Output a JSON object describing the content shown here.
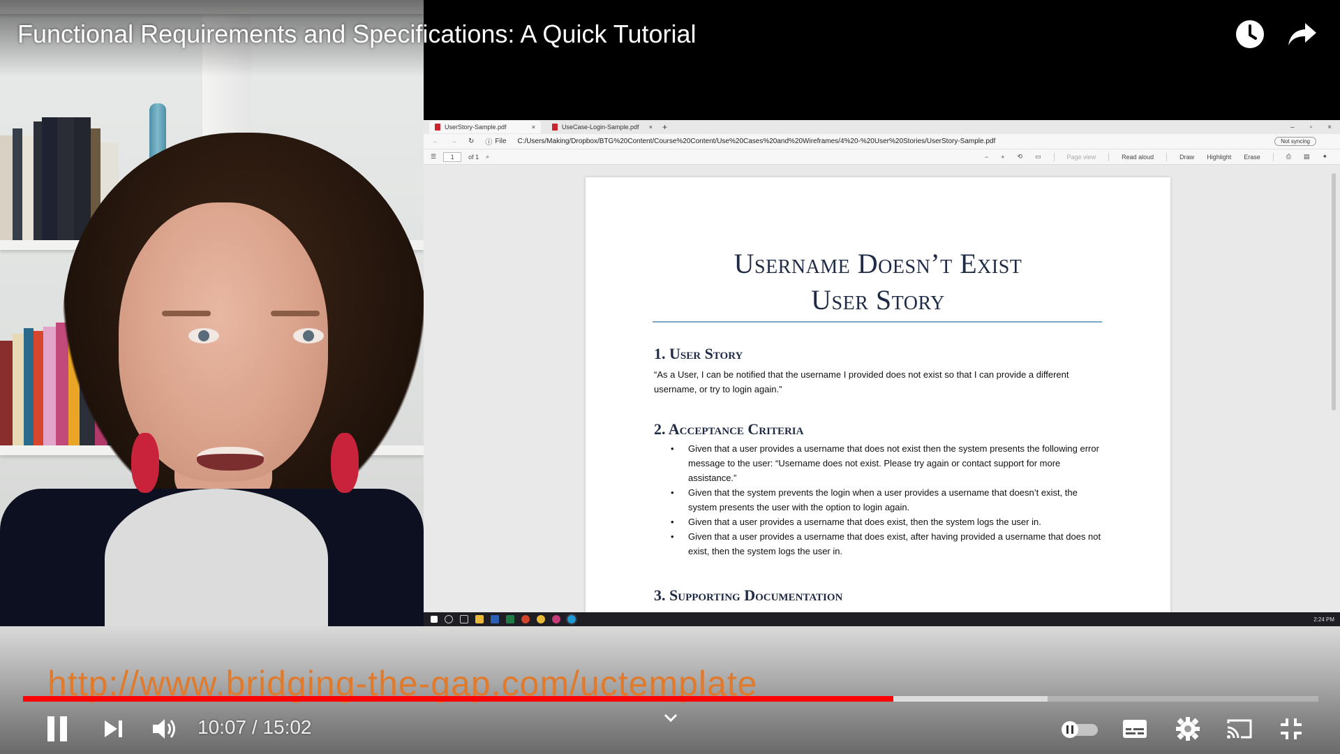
{
  "video": {
    "title": "Functional Requirements and Specifications: A Quick Tutorial",
    "overlay_url": "http://www.bridging-the-gap.com/uctemplate",
    "progress": {
      "played_fraction": 0.672,
      "buffered_fraction": 0.791
    }
  },
  "player_controls": {
    "current_time": "10:07",
    "separator": " / ",
    "duration": "15:02",
    "icons": [
      "pause-icon",
      "next-icon",
      "volume-icon",
      "chevron-down-icon",
      "autoplay-toggle",
      "subtitles-icon",
      "settings-icon",
      "cast-icon",
      "exit-fullscreen-icon",
      "watch-later-icon",
      "share-icon"
    ],
    "accent_color": "#ff0000"
  },
  "browser": {
    "tabs": [
      {
        "label": "UserStory-Sample.pdf",
        "close": "×"
      },
      {
        "label": "UseCase-Login-Sample.pdf",
        "close": "×"
      }
    ],
    "new_tab": "+",
    "window_buttons": [
      "–",
      "▫",
      "×"
    ],
    "address": {
      "protocol": "File",
      "url": "C:/Users/Making/Dropbox/BTG%20Content/Course%20Content/Use%20Cases%20and%20Wireframes/4%20-%20User%20Stories/UserStory-Sample.pdf"
    },
    "pdf_toolbar": {
      "page_current": "1",
      "page_total": "of 1",
      "page_view": "Page view",
      "read_aloud": "Read aloud",
      "draw": "Draw",
      "highlight": "Highlight",
      "erase": "Erase"
    },
    "account": "Not syncing",
    "taskbar_time": "2:24 PM"
  },
  "document": {
    "title_line1": "Username Doesn’t Exist",
    "title_line2": "User Story",
    "sections": {
      "user_story_heading": "1. User Story",
      "user_story_text": "“As a User, I can be notified that the username I provided does not exist so that I can provide a different username, or try to login again.”",
      "acceptance_heading": "2. Acceptance Criteria",
      "criteria": [
        "Given that a user provides a username that does not exist then the system presents the following error message to the user: “Username does not exist. Please try again or contact support for more assistance.”",
        "Given that the system prevents the login when a user provides a username that doesn’t exist, the system presents the user with the option to login again.",
        "Given that a user provides a username that does exist, then the system logs the user in.",
        "Given that a user provides a username that does exist, after having provided a username that does not exist, then the system logs the user in."
      ],
      "supporting_heading": "3. Supporting Documentation"
    }
  }
}
